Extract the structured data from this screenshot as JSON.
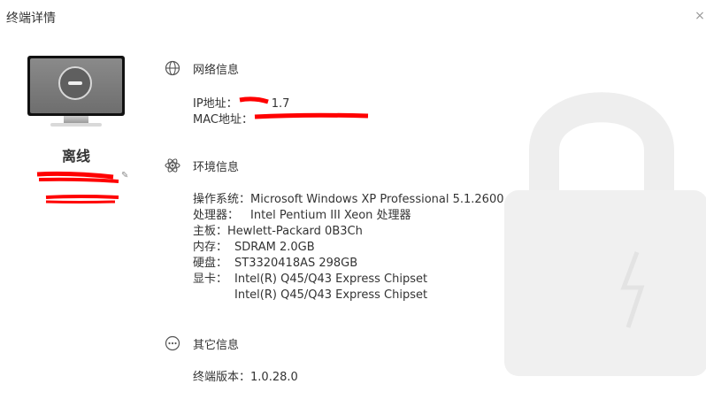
{
  "window": {
    "title": "终端详情",
    "close_glyph": "×"
  },
  "device": {
    "status": "离线"
  },
  "network": {
    "title": "网络信息",
    "ip_label": "IP地址：",
    "ip_value": "1.7",
    "mac_label": "MAC地址："
  },
  "environment": {
    "title": "环境信息",
    "os_label": "操作系统：",
    "os_value": "Microsoft Windows XP Professional 5.1.2600",
    "cpu_label": "处理器：",
    "cpu_value": "Intel Pentium III Xeon 处理器",
    "board_label": "主板：",
    "board_value": "Hewlett-Packard 0B3Ch",
    "mem_label": "内存：",
    "mem_value": "SDRAM 2.0GB",
    "disk_label": "硬盘：",
    "disk_value": "ST3320418AS 298GB",
    "gpu_label": "显卡：",
    "gpu_values": [
      "Intel(R) Q45/Q43 Express Chipset",
      "Intel(R) Q45/Q43 Express Chipset"
    ]
  },
  "other": {
    "title": "其它信息",
    "version_label": "终端版本：",
    "version_value": "1.0.28.0"
  },
  "colors": {
    "redaction": "#ff0000"
  }
}
